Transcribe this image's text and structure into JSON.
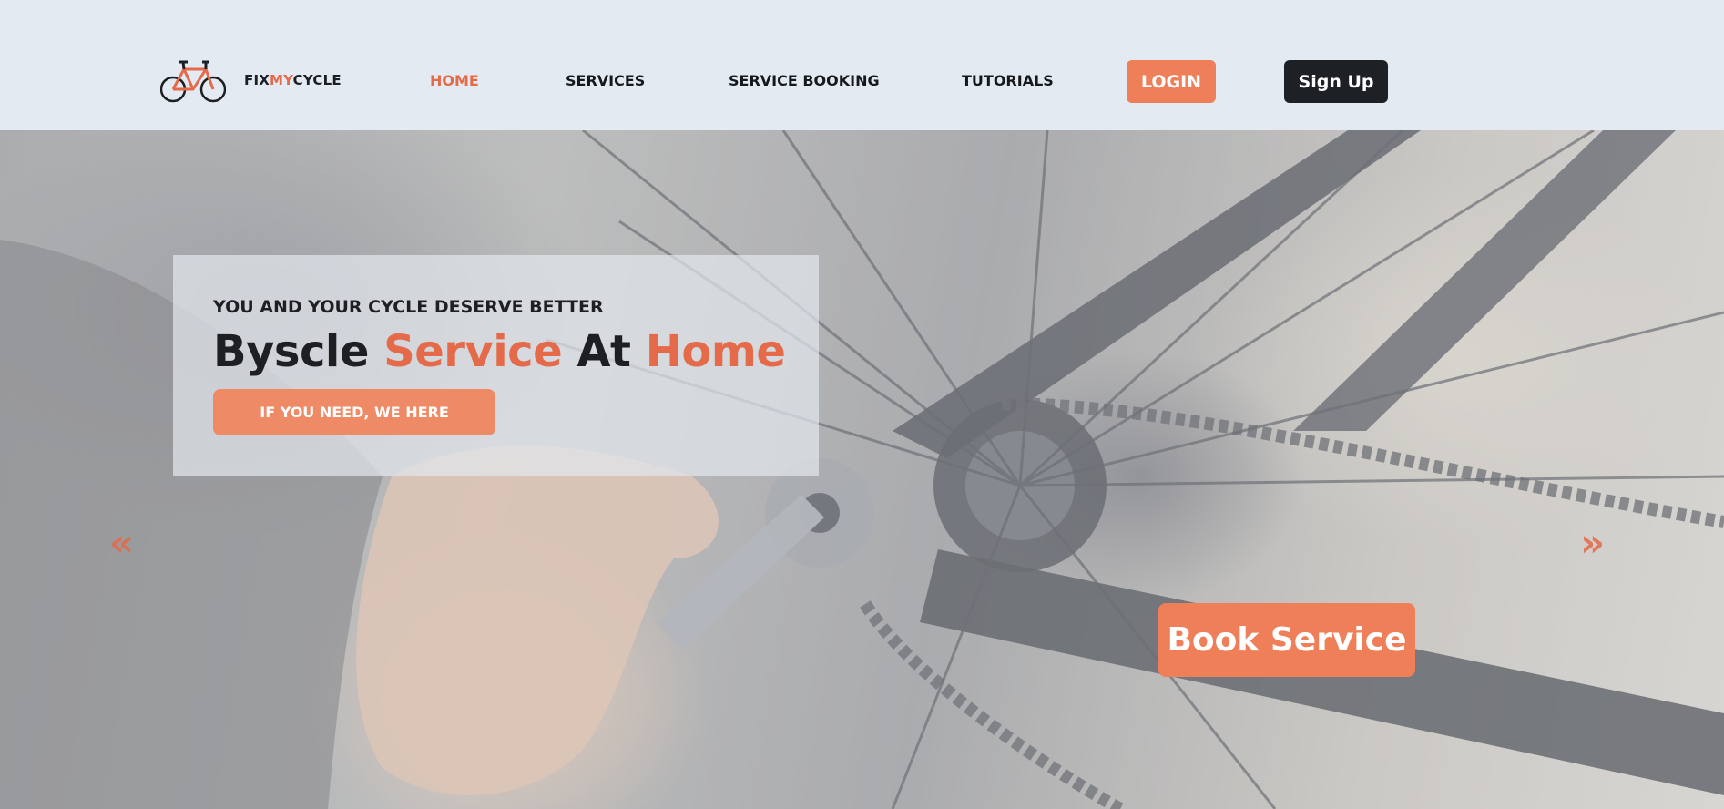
{
  "brand": {
    "logo_icon": "bicycle-icon",
    "name_part1": "FIX",
    "name_part2": "MY",
    "name_part3": "CYCLE",
    "accent_color": "#e46a4a"
  },
  "nav": {
    "home": "HOME",
    "services": "SERVICES",
    "service_booking": "SERVICE BOOKING",
    "tutorials": "TUTORIALS",
    "active": "HOME"
  },
  "auth": {
    "login": "LOGIN",
    "signup": "Sign Up",
    "login_color": "#ee7f59",
    "signup_color": "#1d2126"
  },
  "hero": {
    "kicker": "YOU AND YOUR CYCLE DESERVE BETTER",
    "title_part1": "Byscle ",
    "title_part2": "Service",
    "title_part3": " At ",
    "title_part4": "Home",
    "cta": "IF YOU NEED, WE HERE",
    "prev_arrow": "«",
    "next_arrow": "»",
    "prev_icon": "double-chevron-left-icon",
    "next_icon": "double-chevron-right-icon",
    "background_image": "bicycle-wheel-repair-photo"
  },
  "book_service": {
    "label": "Book Service"
  }
}
